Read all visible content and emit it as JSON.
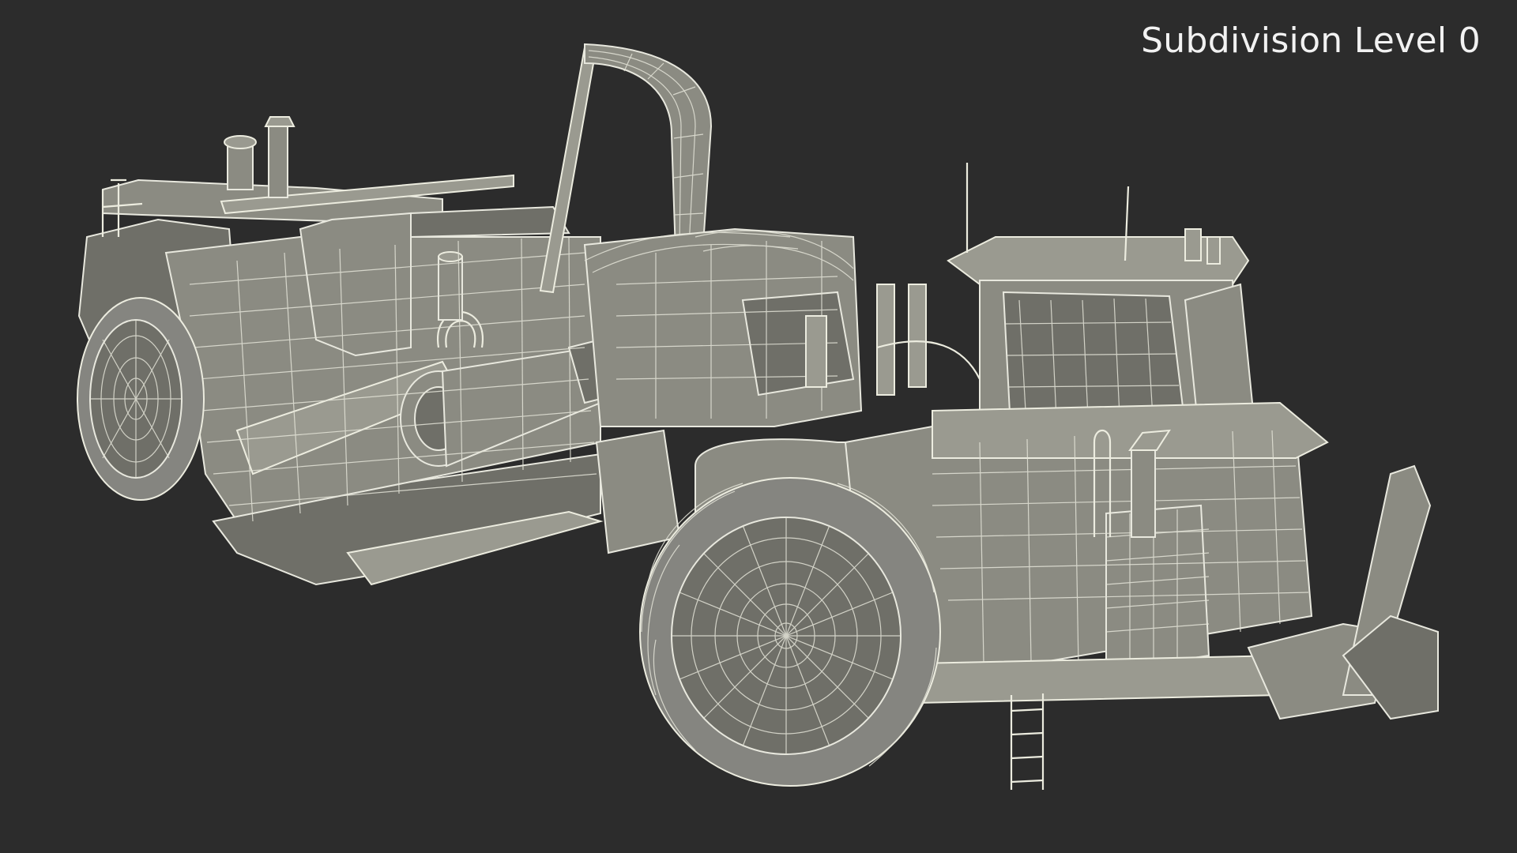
{
  "viewport": {
    "label": "Subdivision Level 0",
    "background": "#2c2c2c",
    "wire_color": "#e8e8de",
    "surface_color": "#8b8b82"
  }
}
